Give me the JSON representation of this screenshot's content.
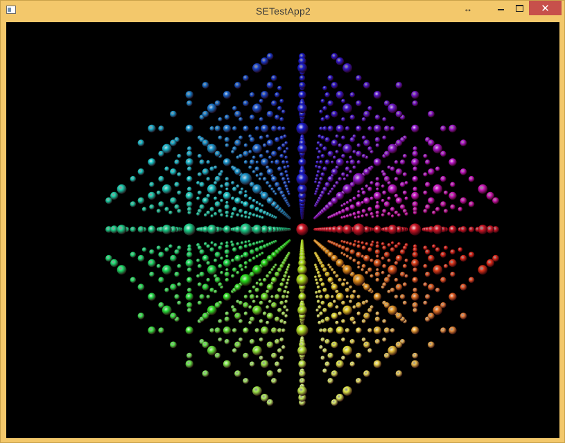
{
  "window": {
    "title": "SETestApp2",
    "close_glyph": "✕",
    "resize_glyph": "↔"
  },
  "icons": {
    "app": "app-window-icon",
    "resize": "resize-arrows-icon",
    "minimize": "minimize-icon",
    "maximize": "maximize-icon",
    "close": "close-icon"
  },
  "scene": {
    "background": "#000000",
    "description_colors": {
      "upper_left": "#7b3fd0",
      "upper": "#d8186a",
      "upper_right": "#e8182a",
      "right": "#ff6a10",
      "lower_right": "#f0c030",
      "lower_left": "#60d8d0",
      "bottom": "#f0e0d8"
    }
  }
}
